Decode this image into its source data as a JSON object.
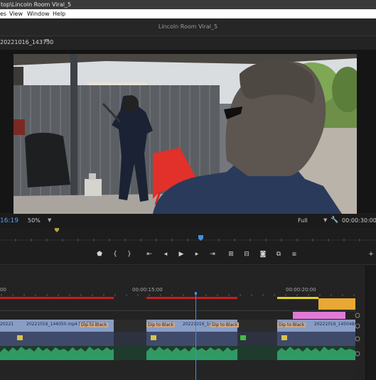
{
  "window": {
    "title": "top\\Lincoln Room Viral_5"
  },
  "menu": {
    "items": [
      "es",
      "View",
      "Window",
      "Help"
    ]
  },
  "workspace": {
    "title": "Lincoln Room Viral_5"
  },
  "monitor": {
    "tab_label": "20221016_143730",
    "menu_icon": "hamburger-icon",
    "timecode": "16:19",
    "zoom": "50%",
    "quality": "Full",
    "duration": "00:00:30:00"
  },
  "timeline": {
    "ruler_labels": [
      "00",
      "00:00:15:00",
      "00:00:20:00"
    ],
    "clips": {
      "v1": [
        {
          "label": "20221"
        },
        {
          "label": "20221016_144050.mp4 [V] 775%"
        },
        {
          "label": "20221016_14"
        },
        {
          "label": "20221016_145048m"
        }
      ],
      "transitions": [
        "Dip to Black",
        "Dip to Black",
        "Dip to Black",
        "Dip to Black"
      ]
    }
  },
  "colors": {
    "accent": "#4fa3f7",
    "clip_blue": "#8a9dc4",
    "audio_green": "#2f9a63",
    "work_area": "#e8a833",
    "render_red": "#c81e1e",
    "clip_pink": "#e07ad8"
  }
}
